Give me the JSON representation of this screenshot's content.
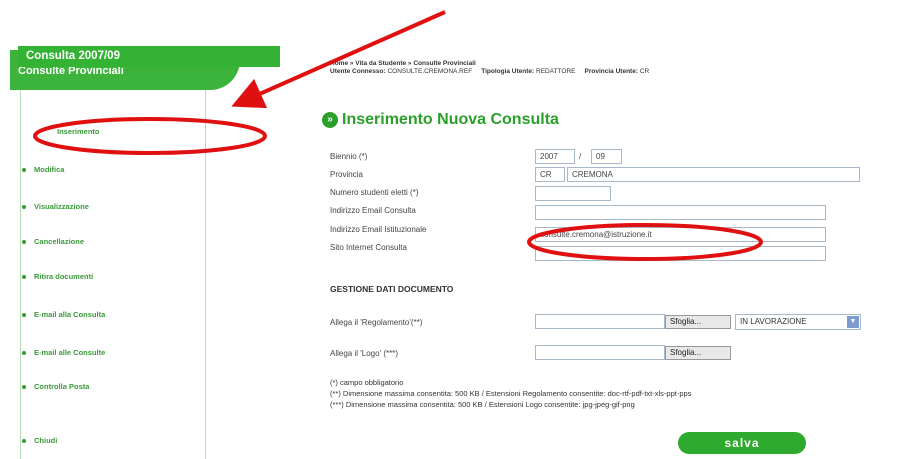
{
  "sidebar": {
    "title": "Consulte Provinciali",
    "subtitle": "Consulta 2007/09",
    "items": [
      {
        "label": "Inserimento"
      },
      {
        "label": "Modifica"
      },
      {
        "label": "Visualizzazione"
      },
      {
        "label": "Cancellazione"
      },
      {
        "label": "Ritira documenti"
      },
      {
        "label": "E-mail alla Consulta"
      },
      {
        "label": "E-mail alle Consulte"
      },
      {
        "label": "Controlla Posta"
      },
      {
        "label": "Chiudi"
      }
    ]
  },
  "header": {
    "breadcrumb": "Home » Vita da Studente » Consulte Provinciali",
    "user_label": "Utente Connesso:",
    "user_value": "CONSULTE.CREMONA.REF",
    "type_label": "Tipologia Utente:",
    "type_value": "REDATTORE",
    "province_label": "Provincia Utente:",
    "province_value": "CR"
  },
  "page": {
    "title": "Inserimento Nuova Consulta",
    "title_icon": "double-chevron-right-icon"
  },
  "form": {
    "biennio_label": "Biennio (*)",
    "biennio_start": "2007",
    "biennio_sep": "/",
    "biennio_end": "09",
    "provincia_label": "Provincia",
    "provincia_code": "CR",
    "provincia_name": "CREMONA",
    "studenti_label": "Numero studenti eletti (*)",
    "studenti_value": "",
    "email_consulta_label": "Indirizzo Email Consulta",
    "email_consulta_value": "",
    "email_istituzionale_label": "Indirizzo Email Istituzionale",
    "email_istituzionale_value": "consulte.cremona@istruzione.it",
    "sito_label": "Sito Internet Consulta",
    "sito_value": ""
  },
  "documents": {
    "section_title": "GESTIONE DATI DOCUMENTO",
    "regolamento_label": "Allega il 'Regolamento'(**)",
    "logo_label": "Allega il 'Logo' (***)",
    "browse_label": "Sfoglia...",
    "status_value": "IN LAVORAZIONE",
    "status_icon": "chevron-down-icon"
  },
  "notes": {
    "required": "(*) campo obbligatorio",
    "reg_note": "(**) Dimensione massima consentita: 500 KB / Estensioni Regolamento consentite: doc-rtf-pdf-txt-xls-ppt-pps",
    "logo_note": "(***) Dimensione massima consentita: 500 KB / Estensioni Logo consentite: jpg-jpeg-gif-png"
  },
  "actions": {
    "save_label": "salva"
  },
  "colors": {
    "brand_green": "#33b233",
    "annotation_red": "#e01010"
  }
}
